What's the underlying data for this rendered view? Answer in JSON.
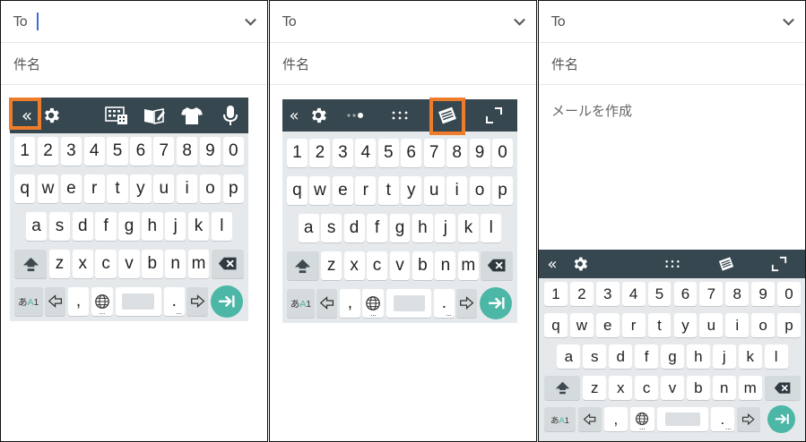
{
  "compose": {
    "to_label": "To",
    "subject_label": "件名",
    "body_placeholder": "メールを作成"
  },
  "keyboard": {
    "digits": [
      "1",
      "2",
      "3",
      "4",
      "5",
      "6",
      "7",
      "8",
      "9",
      "0"
    ],
    "row_q": [
      "q",
      "w",
      "e",
      "r",
      "t",
      "y",
      "u",
      "i",
      "o",
      "p"
    ],
    "row_a": [
      "a",
      "s",
      "d",
      "f",
      "g",
      "h",
      "j",
      "k",
      "l"
    ],
    "row_z": [
      "z",
      "x",
      "c",
      "v",
      "b",
      "n",
      "m"
    ],
    "mode_key": "あA1",
    "comma": ",",
    "period": ".",
    "dots": "..."
  },
  "colors": {
    "toolbar": "#37474f",
    "highlight": "#ee7d2b",
    "enter": "#4cb7a6",
    "kb_bg": "#e6e9ec"
  },
  "icons": {
    "collapse": "«",
    "settings": "gear-icon",
    "keyboard_layout": "keyboard-grid-icon",
    "dictionary": "book-pen-icon",
    "theme": "shirt-icon",
    "mic": "microphone-icon",
    "floating": "floating-keyboard-icon",
    "expand": "expand-icon"
  }
}
